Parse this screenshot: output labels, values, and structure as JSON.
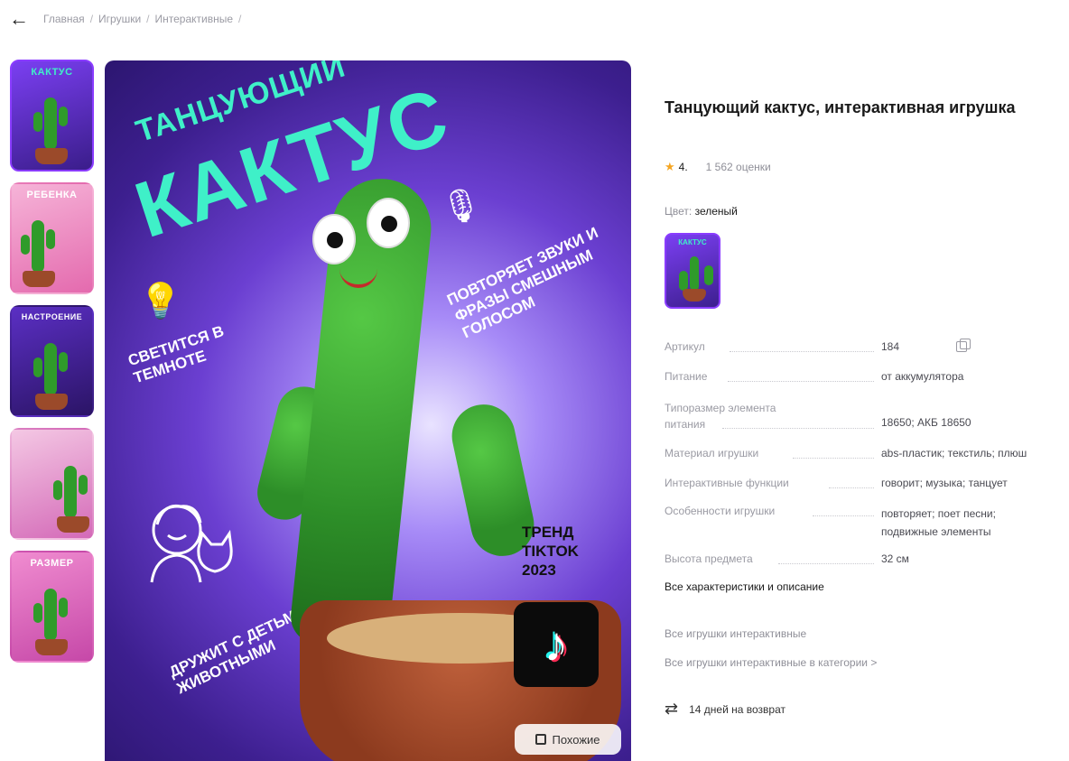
{
  "breadcrumbs": {
    "items": [
      "Главная",
      "Игрушки",
      "Интерактивные"
    ],
    "sep": "/"
  },
  "thumbnails": [
    {
      "label": "КАКТУС"
    },
    {
      "label": "РЕБЕНКА"
    },
    {
      "label": "НАСТРОЕНИЕ"
    },
    {
      "label": ""
    },
    {
      "label": "РАЗМЕР"
    }
  ],
  "main_image": {
    "title_line1": "ТАНЦУЮЩИЙ",
    "title_line2": "КАКТУС",
    "feature_glow": "СВЕТИТСЯ В ТЕМНОТЕ",
    "feature_repeat": "ПОВТОРЯЕТ ЗВУКИ И ФРАЗЫ СМЕШНЫМ ГОЛОСОМ",
    "feature_friends": "ДРУЖИТ С ДЕТЬМИ И ЖИВОТНЫМИ",
    "trend": "ТРЕНД TIKTOK 2023",
    "similar_label": "Похожие"
  },
  "product": {
    "title": "Танцующий кактус, интерактивная игрушка",
    "rating": "4.",
    "rating_count": "1 562 оценки",
    "color_label": "Цвет:",
    "color_value": "зеленый",
    "swatch_label": "КАКТУС"
  },
  "specs": [
    {
      "k": "Артикул",
      "v": "184"
    },
    {
      "k": "Питание",
      "v": "от аккумулятора"
    },
    {
      "k": "Типоразмер элемента питания",
      "v": "18650; АКБ 18650"
    },
    {
      "k": "Материал игрушки",
      "v": "abs-пластик; текстиль; плюш"
    },
    {
      "k": "Интерактивные функции",
      "v": "говорит; музыка; танцует"
    },
    {
      "k": "Особенности игрушки",
      "v": "повторяет; поет песни; подвижные элементы"
    },
    {
      "k": "Высота предмета",
      "v": "32 см"
    }
  ],
  "links": {
    "all_specs": "Все характеристики и описание",
    "all_toys": "Все игрушки интерактивные",
    "all_toys_category": "Все игрушки интерактивные в категории >"
  },
  "return_info": "14 дней на возврат",
  "colors": {
    "accent": "#8a3cff",
    "cactus_text": "#3ff0c8",
    "star": "#f5a623"
  }
}
